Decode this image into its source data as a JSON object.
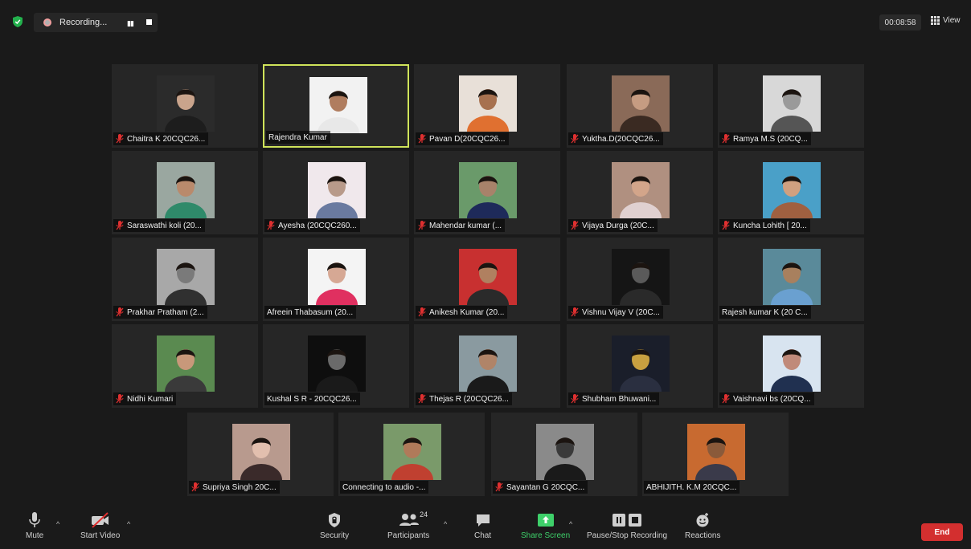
{
  "topbar": {
    "recording_label": "Recording...",
    "timer": "00:08:58",
    "view_label": "View"
  },
  "participants": [
    {
      "name": "Chaitra K 20CQC26...",
      "muted": true,
      "bg": "#2b2b2b",
      "skin": "#c9a48c",
      "shirt": "#1d1d1d"
    },
    {
      "name": "Rajendra Kumar",
      "muted": false,
      "active": true,
      "bg": "#f2f2f2",
      "skin": "#b07d5f",
      "shirt": "#e8e8e8"
    },
    {
      "name": "Pavan D(20CQC26...",
      "muted": true,
      "bg": "#e8e0d8",
      "skin": "#a7714f",
      "shirt": "#e07030"
    },
    {
      "name": "Yuktha.D(20CQC26...",
      "muted": true,
      "bg": "#8a6a58",
      "skin": "#c69c82",
      "shirt": "#3a2a22"
    },
    {
      "name": "Ramya M.S (20CQ...",
      "muted": true,
      "bg": "#d8d8d8",
      "skin": "#9a9a9a",
      "shirt": "#555555"
    },
    {
      "name": "Saraswathi koli (20...",
      "muted": true,
      "bg": "#9aa7a0",
      "skin": "#b98a6c",
      "shirt": "#2f8a6a"
    },
    {
      "name": "Ayesha (20CQC260...",
      "muted": true,
      "bg": "#f0e8ec",
      "skin": "#b89a8a",
      "shirt": "#6a7aa0"
    },
    {
      "name": "Mahendar kumar (...",
      "muted": true,
      "bg": "#6a9a6a",
      "skin": "#a8826a",
      "shirt": "#1e2a5a"
    },
    {
      "name": "Vijaya Durga (20C...",
      "muted": true,
      "bg": "#b09080",
      "skin": "#d3a58a",
      "shirt": "#e0d0d0"
    },
    {
      "name": "Kuncha Lohith [ 20...",
      "muted": true,
      "bg": "#4aa0c8",
      "skin": "#d0a080",
      "shirt": "#a06040"
    },
    {
      "name": "Prakhar Pratham (2...",
      "muted": true,
      "bg": "#a8a8a8",
      "skin": "#7a7a7a",
      "shirt": "#303030"
    },
    {
      "name": "Afreein Thabasum (20...",
      "muted": false,
      "bg": "#f4f4f4",
      "skin": "#d6a894",
      "shirt": "#e03060"
    },
    {
      "name": "Anikesh Kumar (20...",
      "muted": true,
      "bg": "#c83030",
      "skin": "#b08060",
      "shirt": "#2a2a2a"
    },
    {
      "name": "Vishnu Vijay V (20C...",
      "muted": true,
      "bg": "#151515",
      "skin": "#5a5a5a",
      "shirt": "#2a2a2a"
    },
    {
      "name": "Rajesh kumar K (20 C...",
      "muted": false,
      "bg": "#5a8a9a",
      "skin": "#a8805e",
      "shirt": "#6aa0d0"
    },
    {
      "name": "Nidhi Kumari",
      "muted": true,
      "bg": "#5a8a50",
      "skin": "#c8987a",
      "shirt": "#3a3a3a"
    },
    {
      "name": "Kushal S R - 20CQC26...",
      "muted": false,
      "bg": "#0e0e0e",
      "skin": "#6a6a6a",
      "shirt": "#1a1a1a"
    },
    {
      "name": "Thejas R (20CQC26...",
      "muted": true,
      "bg": "#8a9aa0",
      "skin": "#b08468",
      "shirt": "#1a1a1a"
    },
    {
      "name": "Shubham Bhuwani...",
      "muted": true,
      "bg": "#1a1e2a",
      "skin": "#c8a040",
      "shirt": "#2a2f40"
    },
    {
      "name": "Vaishnavi bs (20CQ...",
      "muted": true,
      "bg": "#d8e4f0",
      "skin": "#c08a7a",
      "shirt": "#203050"
    },
    {
      "name": "Supriya Singh 20C...",
      "muted": true,
      "bg": "#b89a8e",
      "skin": "#e2bfae",
      "shirt": "#3a2a2a"
    },
    {
      "name": "Connecting to audio -...",
      "muted": false,
      "bg": "#7a9a6a",
      "skin": "#b07a5a",
      "shirt": "#c04030"
    },
    {
      "name": "Sayantan G 20CQC...",
      "muted": true,
      "bg": "#8a8a8a",
      "skin": "#3a3a3a",
      "shirt": "#1a1a1a"
    },
    {
      "name": "ABHIJITH. K.M 20CQC...",
      "muted": false,
      "bg": "#c86a30",
      "skin": "#8a5a3a",
      "shirt": "#3a3a4a"
    }
  ],
  "toolbar": {
    "mute_label": "Mute",
    "start_video_label": "Start Video",
    "security_label": "Security",
    "participants_label": "Participants",
    "participants_count": "24",
    "chat_label": "Chat",
    "share_screen_label": "Share Screen",
    "pause_stop_label": "Pause/Stop Recording",
    "reactions_label": "Reactions",
    "end_label": "End"
  },
  "colors": {
    "active_speaker": "#cfe35a",
    "share_green": "#3ed06a",
    "end_red": "#d32f2f",
    "mic_off_red": "#e03030"
  }
}
